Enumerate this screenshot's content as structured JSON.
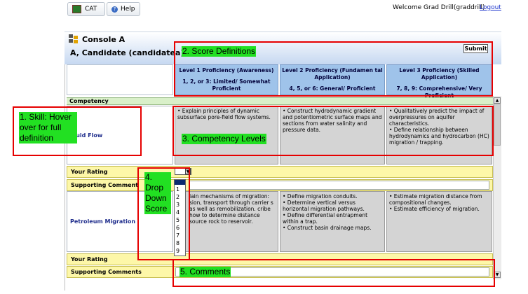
{
  "topbar": {
    "tab_cat": "CAT",
    "tab_help": "Help",
    "welcome": "Welcome Grad Drill(graddrill)",
    "logout": "Logout"
  },
  "header": {
    "console_title": "Console A",
    "candidate": "A, Candidate (candidatea)",
    "submit_label": "Submit"
  },
  "levels": [
    {
      "title": "Level 1 Proficiency (Awareness)",
      "scores": "1, 2, or 3: Limited/ Somewhat Proficient"
    },
    {
      "title": "Level 2 Proficiency (Fundamen tal Application)",
      "scores": "4, 5, or 6: General/ Proficient"
    },
    {
      "title": "Level 3 Proficiency (Skilled Application)",
      "scores": "7, 8, 9: Comprehensive/ Very Proficient"
    }
  ],
  "competency_label": "Competency",
  "skills": [
    {
      "name": "Fluid Flow",
      "levels": [
        "• Explain principles of dynamic subsurface pore-field flow systems.",
        "• Construct hydrodynamic gradient and potentiometric surface maps and sections from water salinity and pressure data.",
        "• Qualitatively predict the impact of overpressures on aquifer characteristics.\n• Define relationship between hydrodynamics and hydrocarbon (HC) migration / trapping."
      ]
    },
    {
      "name": "Petroleum Migration",
      "levels": [
        "lain mechanisms of migration: sion, transport through carrier s as well as remobilization. cribe how to determine distance source rock to reservoir.",
        "• Define migration conduits.\n• Determine vertical versus horizontal migration pathways.\n• Define differential entrapment within a trap.\n• Construct basin drainage maps.",
        "• Estimate migration distance from compositional changes.\n• Estimate efficiency of migration."
      ]
    }
  ],
  "row_labels": {
    "rating": "Your Rating",
    "comments": "Supporting Comments",
    "comments_truncated": "Supporting Comment"
  },
  "dropdown_options": [
    "1",
    "2",
    "3",
    "4",
    "5",
    "6",
    "7",
    "8",
    "9"
  ],
  "annotations": [
    "1. Skill: Hover over for full definition",
    "2. Score Definitions",
    "3. Competency Levels",
    "4. Drop Down Score",
    "5. Comments"
  ],
  "colors": {
    "annotation_border": "#e60000",
    "annotation_label_bg": "#22e022",
    "level_header_bg": "#9fc3ea",
    "rating_row_bg": "#fdf7a8",
    "competency_bar_bg": "#d9f0c9"
  }
}
